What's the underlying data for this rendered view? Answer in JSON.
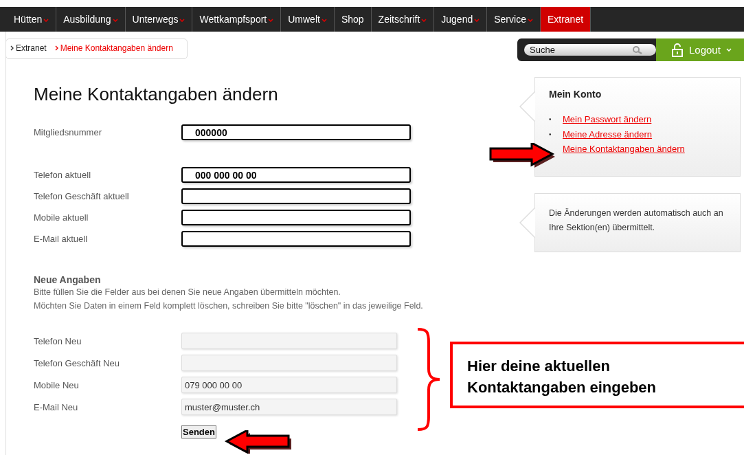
{
  "nav": {
    "items": [
      {
        "label": "Hütten",
        "dropdown": true,
        "selected": false
      },
      {
        "label": "Ausbildung",
        "dropdown": true,
        "selected": false
      },
      {
        "label": "Unterwegs",
        "dropdown": true,
        "selected": false
      },
      {
        "label": "Wettkampfsport",
        "dropdown": true,
        "selected": false
      },
      {
        "label": "Umwelt",
        "dropdown": true,
        "selected": false
      },
      {
        "label": "Shop",
        "dropdown": false,
        "selected": false
      },
      {
        "label": "Zeitschrift",
        "dropdown": true,
        "selected": false
      },
      {
        "label": "Jugend",
        "dropdown": true,
        "selected": false
      },
      {
        "label": "Service",
        "dropdown": true,
        "selected": false
      },
      {
        "label": "Extranet",
        "dropdown": false,
        "selected": true
      }
    ]
  },
  "breadcrumb": [
    {
      "label": "Extranet",
      "current": false
    },
    {
      "label": "Meine Kontaktangaben ändern",
      "current": true
    }
  ],
  "search": {
    "placeholder": "Suche"
  },
  "logout": {
    "label": "Logout"
  },
  "title": "Meine Kontaktangaben ändern",
  "current_fields": [
    {
      "label": "Mitgliedsnummer",
      "value": "000000"
    },
    {
      "label": "Telefon aktuell",
      "value": "000 000 00 00"
    },
    {
      "label": "Telefon Geschäft aktuell"
    },
    {
      "label": "Mobile aktuell"
    },
    {
      "label": "E-Mail aktuell"
    }
  ],
  "new_section": {
    "heading": "Neue Angaben",
    "instructions": [
      "Bitte füllen Sie die Felder aus bei denen Sie neue Angaben übermitteln möchten.",
      "Möchten Sie Daten in einem Feld komplett löschen, schreiben Sie bitte \"löschen\" in das jeweilige Feld."
    ]
  },
  "new_fields": [
    {
      "label": "Telefon Neu"
    },
    {
      "label": "Telefon Geschäft Neu"
    },
    {
      "label": "Mobile Neu",
      "value": "079 000 00 00"
    },
    {
      "label": "E-Mail Neu",
      "value": "muster@muster.ch"
    }
  ],
  "submit": {
    "label": "Senden"
  },
  "sidebar": {
    "account": {
      "title": "Mein Konto",
      "links": [
        {
          "bullet": "•",
          "label": "Mein Passwort ändern"
        },
        {
          "bullet": "•",
          "label": "Meine Adresse ändern"
        },
        {
          "label": "Meine Kontaktangaben ändern"
        }
      ]
    },
    "note": "Die Änderungen werden automatisch auch an Ihre Sektion(en) übermittelt."
  },
  "annotation": {
    "callout": "Hier deine aktuellen Kontaktangaben eingeben"
  }
}
